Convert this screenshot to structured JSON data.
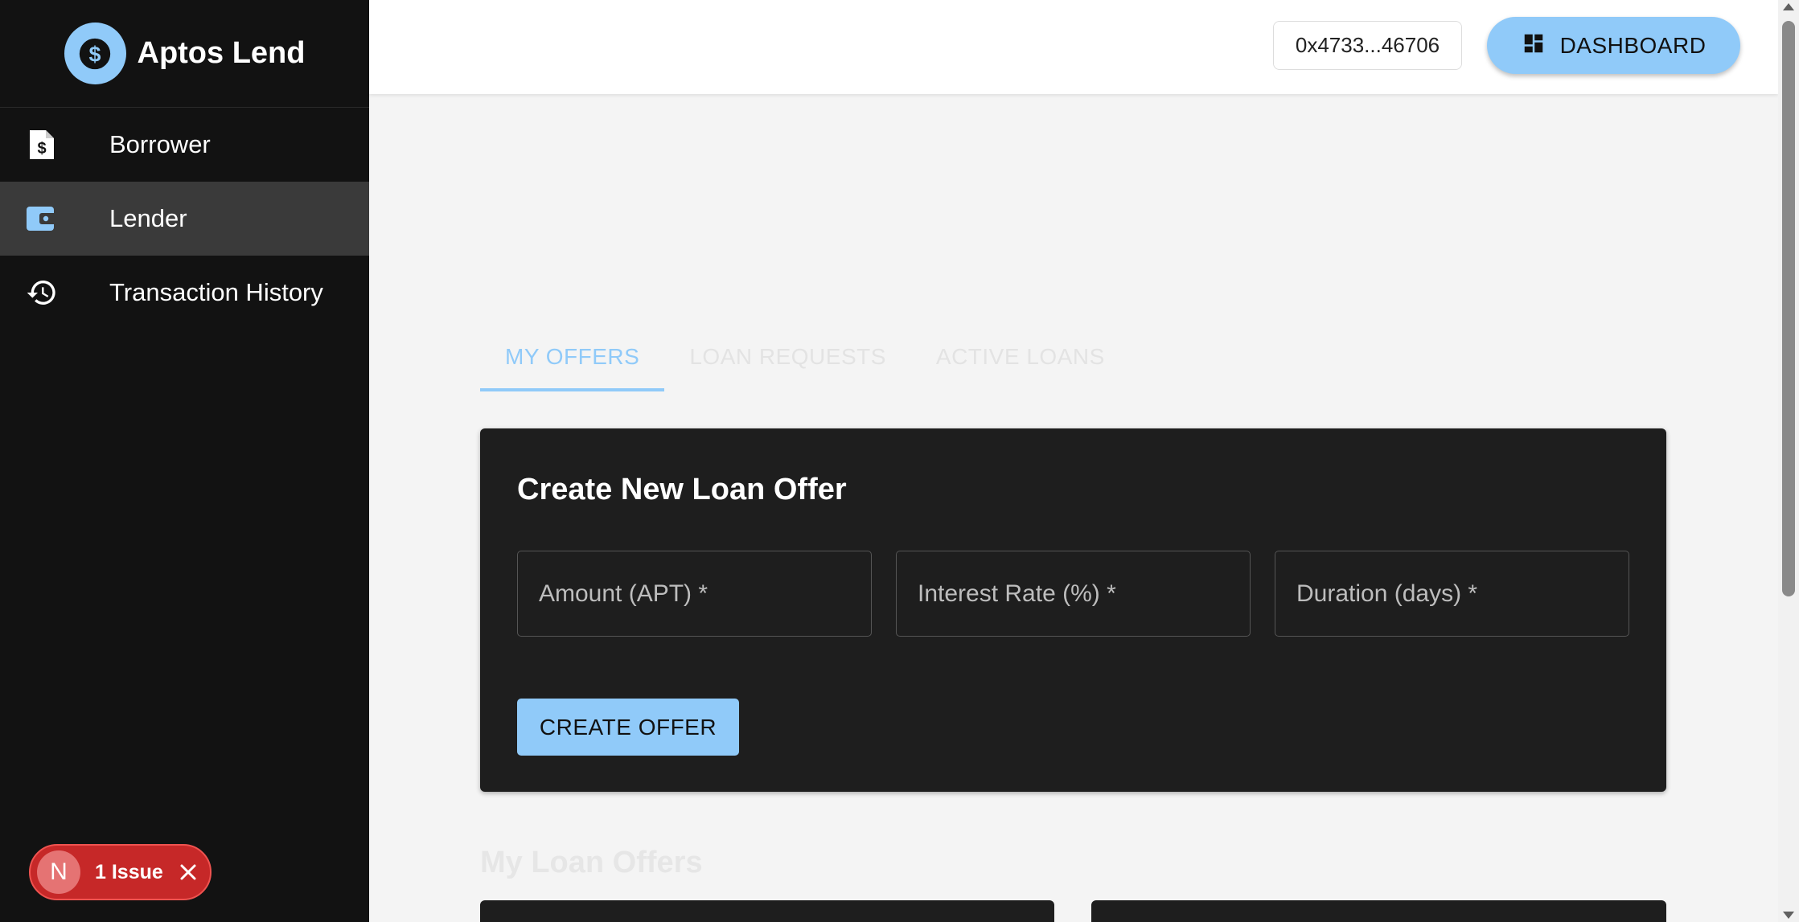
{
  "app": {
    "name": "Aptos Lend",
    "logo_icon": "dollar-circle-icon"
  },
  "sidebar": {
    "items": [
      {
        "label": "Borrower",
        "icon": "document-dollar-icon",
        "active": false
      },
      {
        "label": "Lender",
        "icon": "wallet-icon",
        "active": true
      },
      {
        "label": "Transaction History",
        "icon": "history-icon",
        "active": false
      }
    ]
  },
  "header": {
    "wallet_address": "0x4733...46706",
    "dashboard_label": "DASHBOARD"
  },
  "tabs": [
    {
      "label": "MY OFFERS",
      "active": true
    },
    {
      "label": "LOAN REQUESTS",
      "active": false
    },
    {
      "label": "ACTIVE LOANS",
      "active": false
    }
  ],
  "create_offer": {
    "title": "Create New Loan Offer",
    "fields": [
      {
        "label": "Amount (APT) *",
        "value": ""
      },
      {
        "label": "Interest Rate (%) *",
        "value": ""
      },
      {
        "label": "Duration (days) *",
        "value": ""
      }
    ],
    "button_label": "CREATE OFFER"
  },
  "offers_section": {
    "title": "My Loan Offers"
  },
  "issue_badge": {
    "letter": "N",
    "text": "1 Issue"
  },
  "colors": {
    "accent": "#90caf9",
    "sidebar_bg": "#121212",
    "card_bg": "#1e1e1e",
    "issue_red": "#c62828"
  }
}
